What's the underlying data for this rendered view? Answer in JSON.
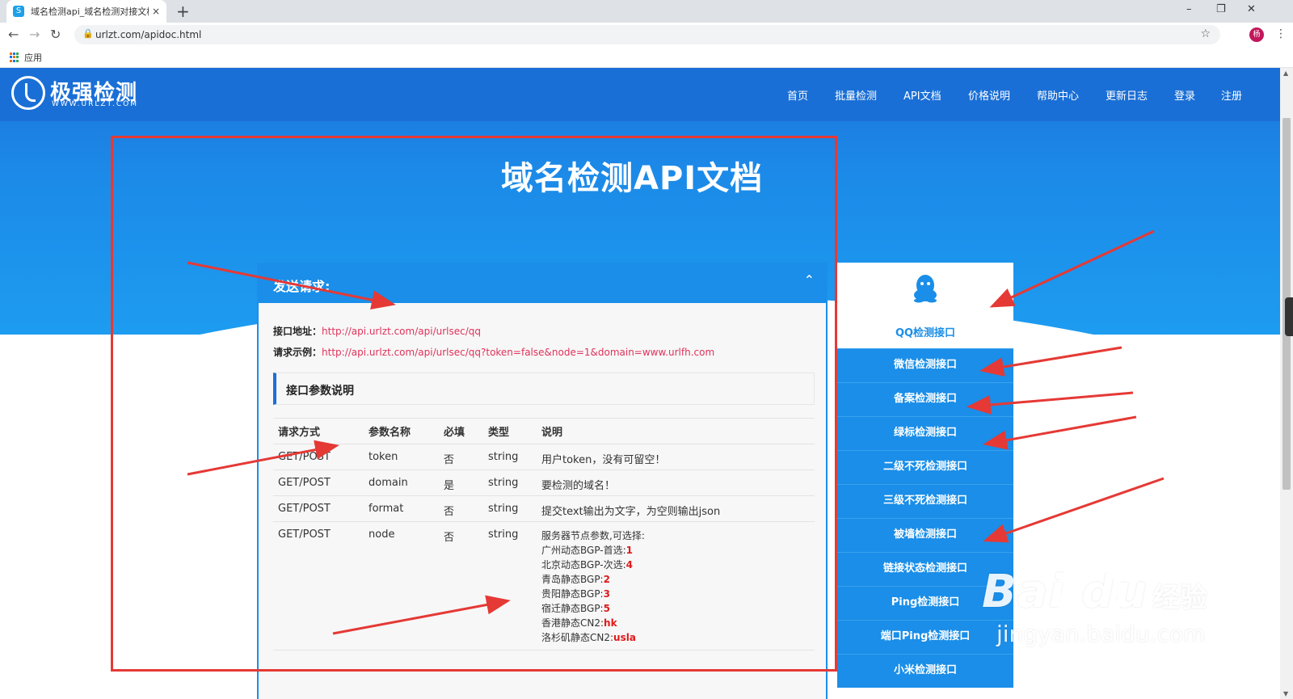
{
  "browser": {
    "tab_title": "域名检测api_域名检测对接文档-",
    "tab_close": "×",
    "new_tab": "+",
    "url": "urlzt.com/apidoc.html",
    "bookmark_apps": "应用",
    "profile_initial": "杨",
    "window_controls": {
      "minimize": "–",
      "restore": "❐",
      "close": "✕"
    }
  },
  "site": {
    "logo_name": "极强检测",
    "logo_sub": "WWW.URLZT.COM",
    "nav": [
      "首页",
      "批量检测",
      "API文档",
      "价格说明",
      "帮助中心",
      "更新日志",
      "登录",
      "注册"
    ]
  },
  "page": {
    "title": "域名检测API文档"
  },
  "request_panel": {
    "title": "发送请求:",
    "endpoint_label": "接口地址：",
    "endpoint_url": "http://api.urlzt.com/api/urlsec/qq",
    "example_label": "请求示例：",
    "example_url": "http://api.urlzt.com/api/urlsec/qq?token=false&node=1&domain=www.urlfh.com",
    "params_heading": "接口参数说明",
    "table": {
      "headers": [
        "请求方式",
        "参数名称",
        "必填",
        "类型",
        "说明"
      ],
      "rows": [
        [
          "GET/POST",
          "token",
          "否",
          "string",
          "用户token，没有可留空！"
        ],
        [
          "GET/POST",
          "domain",
          "是",
          "string",
          "要检测的域名！"
        ],
        [
          "GET/POST",
          "format",
          "否",
          "string",
          "提交text输出为文字，为空则输出json"
        ],
        [
          "GET/POST",
          "node",
          "否",
          "string",
          "服务器节点参数,可选择:"
        ]
      ],
      "node_options": [
        {
          "name": "广州动态BGP-首选:",
          "value": "1"
        },
        {
          "name": "北京动态BGP-次选:",
          "value": "4"
        },
        {
          "name": "青岛静态BGP:",
          "value": "2"
        },
        {
          "name": "贵阳静态BGP:",
          "value": "3"
        },
        {
          "name": "宿迁静态BGP:",
          "value": "5"
        },
        {
          "name": "香港静态CN2:",
          "value": "hk"
        },
        {
          "name": "洛杉矶静态CN2:",
          "value": "usla"
        }
      ]
    }
  },
  "sidebar": {
    "active": "QQ检测接口",
    "items": [
      "微信检测接口",
      "备案检测接口",
      "绿标检测接口",
      "二级不死检测接口",
      "三级不死检测接口",
      "被墙检测接口",
      "链接状态检测接口",
      "Ping检测接口",
      "端口Ping检测接口",
      "小米检测接口"
    ]
  },
  "watermark": {
    "brand": "Bai du",
    "jingyan": "经验",
    "url": "jingyan.baidu.com"
  },
  "colors": {
    "brand_blue": "#1a6fd6",
    "panel_blue": "#1a8ee8",
    "link_pink": "#e0325a",
    "annotation_red": "#e53935",
    "node_value_red": "#e01a1a"
  }
}
